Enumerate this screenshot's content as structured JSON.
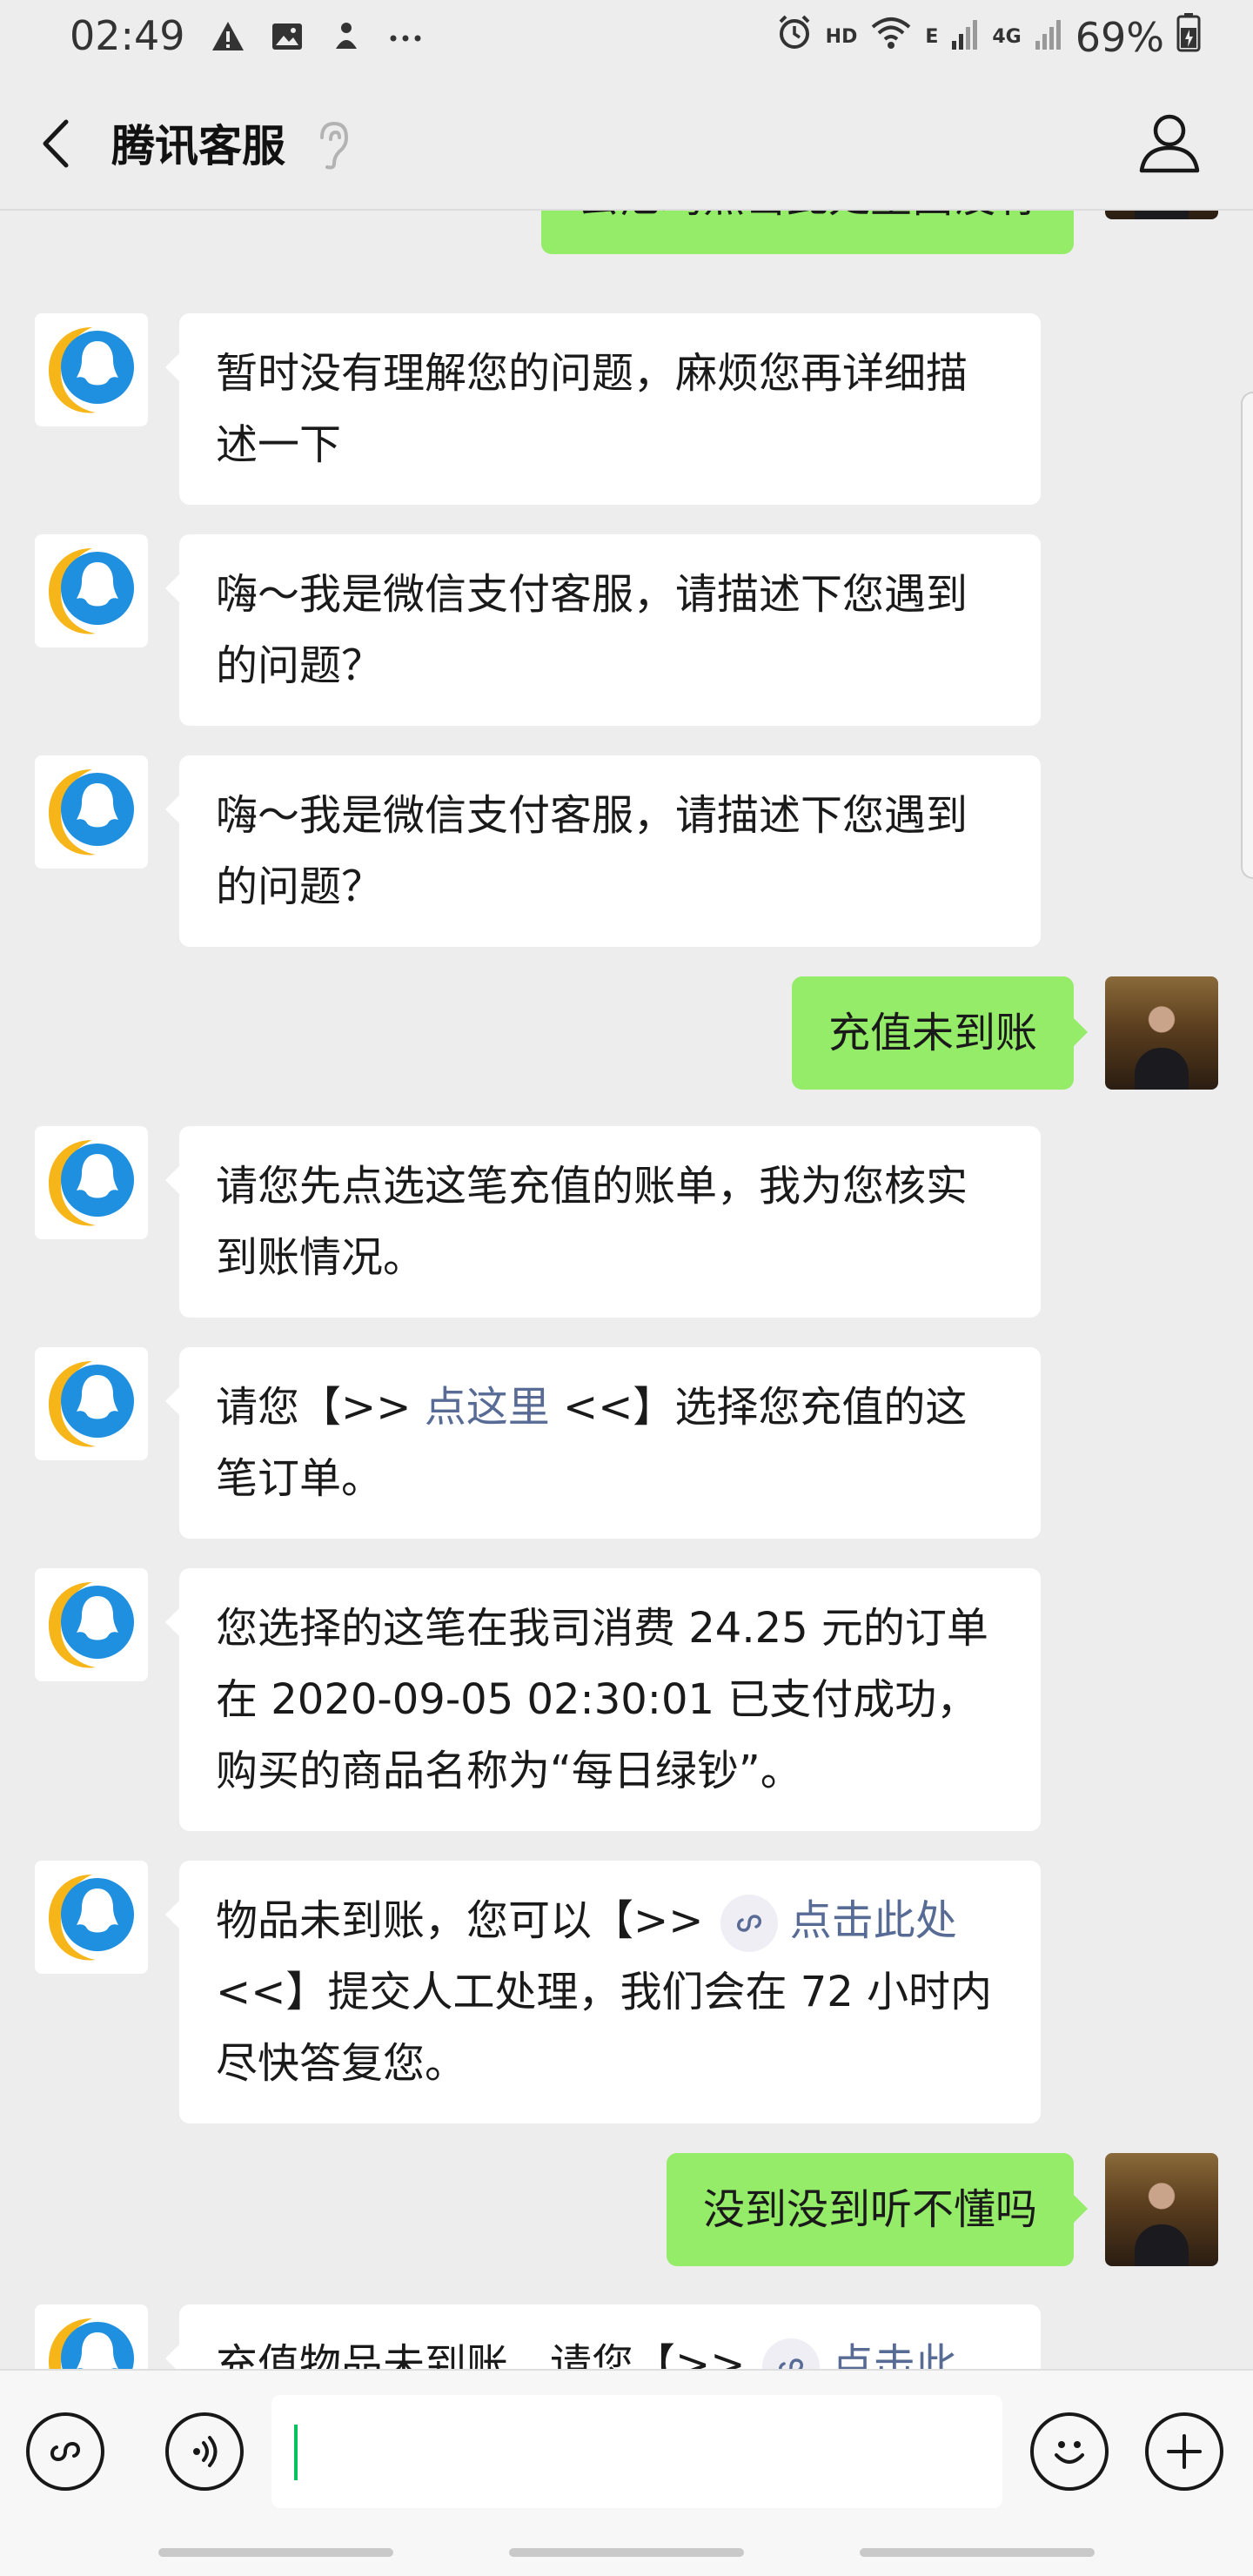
{
  "status_bar": {
    "time": "02:49",
    "network_hd": "HD",
    "network_e": "E",
    "network_4g": "4G",
    "battery": "69%"
  },
  "header": {
    "title": "腾讯客服"
  },
  "messages": [
    {
      "side": "right",
      "text": "去尼玛点击此处里面没有"
    },
    {
      "side": "left",
      "text": "暂时没有理解您的问题，麻烦您再详细描述一下"
    },
    {
      "side": "left",
      "text": "嗨～我是微信支付客服，请描述下您遇到的问题？"
    },
    {
      "side": "left",
      "text": "嗨～我是微信支付客服，请描述下您遇到的问题？"
    },
    {
      "side": "right",
      "text": "充值未到账"
    },
    {
      "side": "left",
      "text": "请您先点选这笔充值的账单，我为您核实到账情况。"
    },
    {
      "side": "left",
      "prefix": "请您【>> ",
      "link": "点这里",
      "suffix": " <<】选择您充值的这笔订单。"
    },
    {
      "side": "left",
      "text": "您选择的这笔在我司消费 24.25 元的订单在 2020-09-05 02:30:01 已支付成功，购买的商品名称为“每日绿钞”。"
    },
    {
      "side": "left",
      "prefix": "物品未到账，您可以【>> ",
      "link": "点击此处",
      "suffix": " <<】提交人工处理，我们会在 72 小时内尽快答复您。"
    },
    {
      "side": "right",
      "text": "没到没到听不懂吗"
    },
    {
      "side": "left",
      "prefix": "充值物品未到账，请您【>> ",
      "link": "点击此"
    }
  ],
  "icons": {
    "back": "chevron-left-icon",
    "ear": "ear-icon",
    "profile": "person-icon",
    "mini_program": "link-icon",
    "voice": "voice-icon",
    "emoji": "emoji-icon",
    "add": "plus-icon"
  },
  "colors": {
    "background": "#ededed",
    "user_bubble": "#95ec69",
    "bot_bubble": "#ffffff",
    "link": "#576b95",
    "caret": "#07c160"
  }
}
